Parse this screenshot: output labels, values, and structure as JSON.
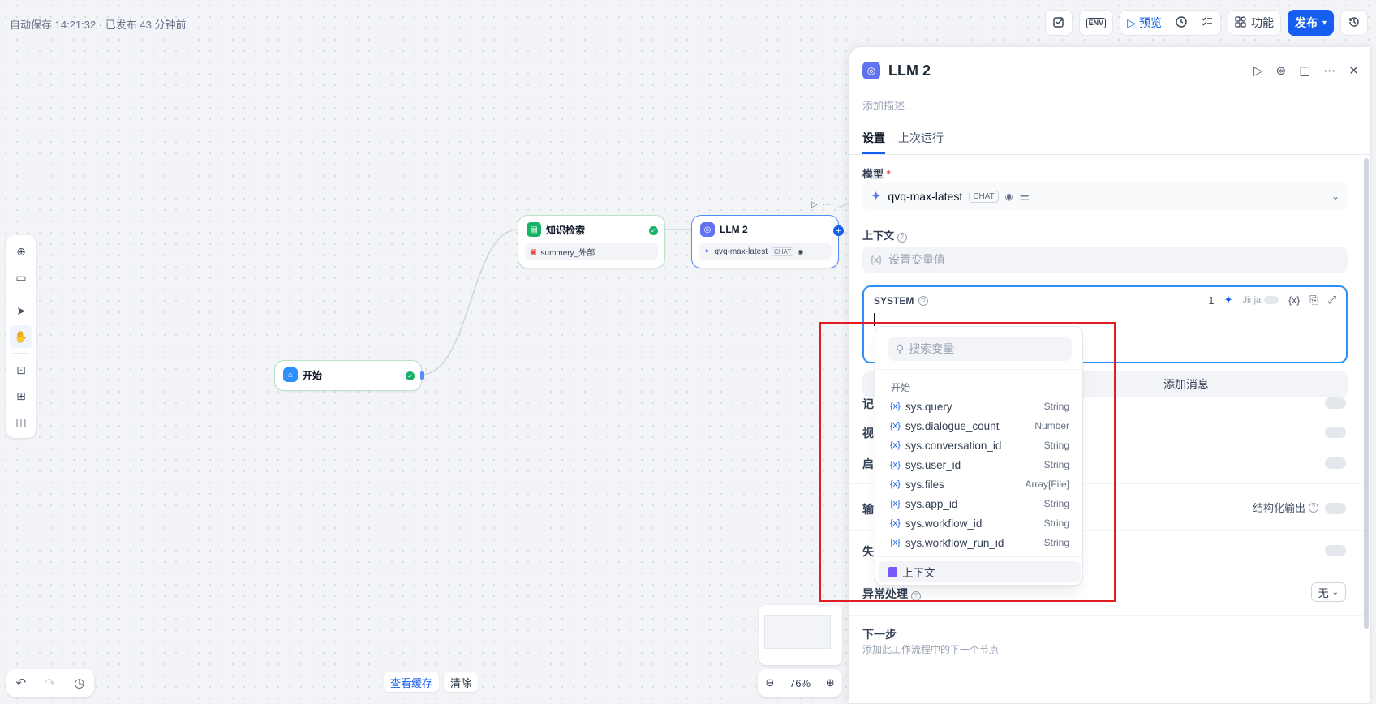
{
  "autosave_text": "自动保存 14:21:32 · 已发布 43 分钟前",
  "toolbar": {
    "env_label": "ENV",
    "preview_label": "预览",
    "features_label": "功能",
    "publish_label": "发布"
  },
  "nodes": {
    "start": {
      "title": "开始"
    },
    "knowledge": {
      "title": "知识检索",
      "dataset": "summery_外部"
    },
    "llm": {
      "title": "LLM 2",
      "model": "qvq-max-latest",
      "badge": "CHAT"
    }
  },
  "bottom": {
    "view_cache": "查看缓存",
    "clear": "清除",
    "zoom": "76%"
  },
  "panel": {
    "title": "LLM 2",
    "description_placeholder": "添加描述...",
    "tabs": [
      "设置",
      "上次运行"
    ],
    "model_label": "模型",
    "required_mark": "*",
    "model_name": "qvq-max-latest",
    "model_badge": "CHAT",
    "context_label": "上下文",
    "context_placeholder": "设置变量值",
    "system_label": "SYSTEM",
    "system_count": "1",
    "jinja_label": "Jinja",
    "add_message": "添加消息",
    "row_memory": "记",
    "row_vision": "视",
    "row_enable": "启",
    "row_output": "输",
    "structured_output": "结构化输出",
    "retry_label": "失败时重试",
    "exception_label": "异常处理",
    "exception_value": "无",
    "next_step_label": "下一步",
    "next_step_desc": "添加此工作流程中的下一个节点"
  },
  "dropdown": {
    "search_placeholder": "搜索变量",
    "group_title": "开始",
    "items": [
      {
        "name": "sys.query",
        "type": "String"
      },
      {
        "name": "sys.dialogue_count",
        "type": "Number"
      },
      {
        "name": "sys.conversation_id",
        "type": "String"
      },
      {
        "name": "sys.user_id",
        "type": "String"
      },
      {
        "name": "sys.files",
        "type": "Array[File]"
      },
      {
        "name": "sys.app_id",
        "type": "String"
      },
      {
        "name": "sys.workflow_id",
        "type": "String"
      },
      {
        "name": "sys.workflow_run_id",
        "type": "String"
      }
    ],
    "context_item": "上下文"
  },
  "colors": {
    "accent": "#155eef",
    "highlight": "#e31b23",
    "success": "#17b26a"
  }
}
